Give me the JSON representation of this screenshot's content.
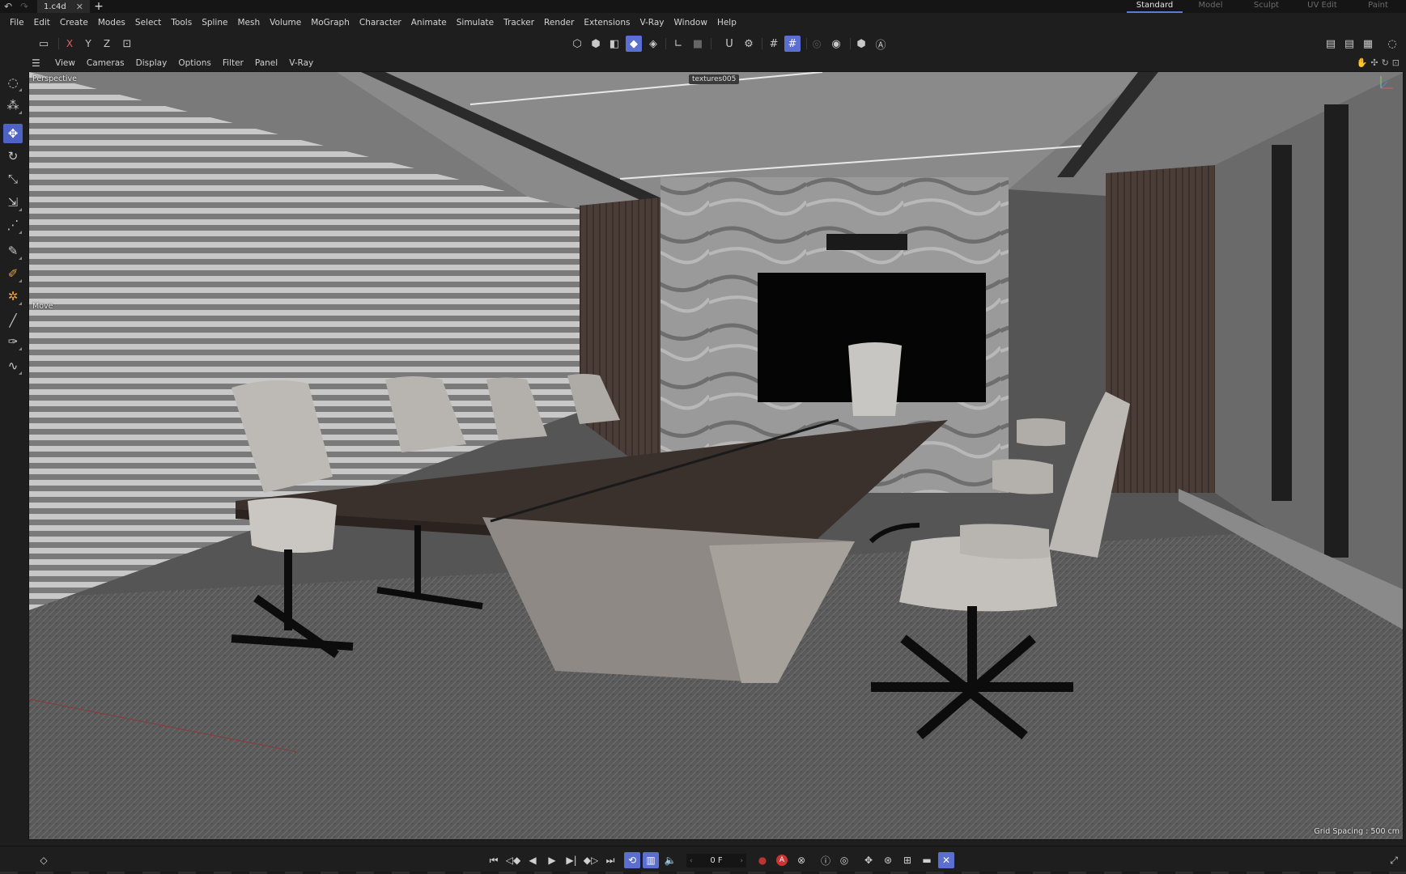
{
  "titlebar": {
    "doc_tab": "1.c4d",
    "layouts": [
      "Standard",
      "Model",
      "Sculpt",
      "UV Edit",
      "Paint"
    ],
    "active_layout": "Standard"
  },
  "menubar": {
    "items": [
      "File",
      "Edit",
      "Create",
      "Modes",
      "Select",
      "Tools",
      "Spline",
      "Mesh",
      "Volume",
      "MoGraph",
      "Character",
      "Animate",
      "Simulate",
      "Tracker",
      "Render",
      "Extensions",
      "V-Ray",
      "Window",
      "Help"
    ]
  },
  "toolbar": {
    "axis_x": "X",
    "axis_y": "Y",
    "axis_z": "Z"
  },
  "viewport_menu": {
    "items": [
      "View",
      "Cameras",
      "Display",
      "Options",
      "Filter",
      "Panel",
      "V-Ray"
    ]
  },
  "viewport": {
    "camera_label": "Perspective",
    "tool_label": "Move",
    "texture_tag": "textures005",
    "grid_spacing": "Grid Spacing : 500 cm"
  },
  "timeline": {
    "frame": "0 F"
  },
  "colors": {
    "accent": "#5b6fd0",
    "background": "#1e1e1e",
    "record": "#cc3333"
  }
}
